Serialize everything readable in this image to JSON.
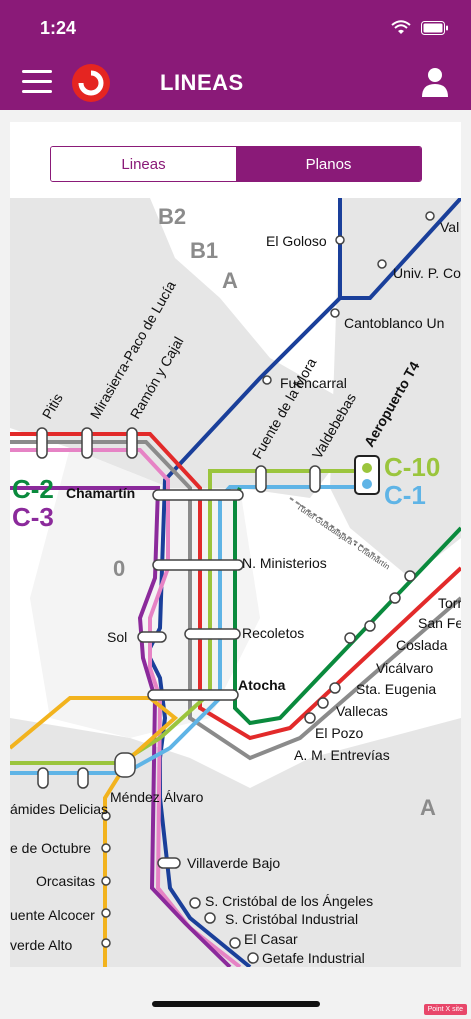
{
  "status": {
    "time": "1:24"
  },
  "header": {
    "title": "LINEAS"
  },
  "tabs": [
    {
      "label": "Lineas",
      "active": false
    },
    {
      "label": "Planos",
      "active": true
    }
  ],
  "map": {
    "zones": [
      "B2",
      "B1",
      "A",
      "0",
      "A"
    ],
    "stations": {
      "el_goloso": "El Goloso",
      "val": "Val",
      "univ_p_co": "Univ. P. Co",
      "cantoblanco": "Cantoblanco Un",
      "fuencarral": "Fuencarral",
      "pitis": "Pitis",
      "mirasierra": "Mirasierra-Paco de Lucía",
      "ramon_cajal": "Ramón y Cajal",
      "fuente_mora": "Fuente de la Mora",
      "valdebebas": "Valdebebas",
      "aeropuerto": "Aeropuerto T4",
      "chamartin": "Chamartín",
      "nuevos_ministerios": "N. Ministerios",
      "recoletos": "Recoletos",
      "sol": "Sol",
      "atocha": "Atocha",
      "torr": "Torr",
      "san_fe": "San Fe",
      "coslada": "Coslada",
      "vicalvaro": "Vicálvaro",
      "sta_eugenia": "Sta. Eugenia",
      "vallecas": "Vallecas",
      "el_pozo": "El Pozo",
      "am_entrevias": "A. M. Entrevías",
      "piramides_delicias": "ámides Delicias",
      "mendez_alvaro": "Méndez Álvaro",
      "doce_octubre": "e de Octubre",
      "orcasitas": "Orcasitas",
      "puente_alcocer": "uente Alcocer",
      "villaverde_bajo": "Villaverde Bajo",
      "villaverde_alto": "verde Alto",
      "s_cristobal_angeles": "S. Cristóbal de los Ángeles",
      "s_cristobal_industrial": "S. Cristóbal Industrial",
      "el_casar": "El Casar",
      "getafe_industrial": "Getafe Industrial"
    },
    "lines": {
      "c2": "C-2",
      "c3": "C-3",
      "c10": "C-10",
      "c1": "C-1"
    },
    "tunnel_label": "Túnel Guadalajara • Chamartín"
  },
  "colors": {
    "brand": "#8a1a78",
    "c1": "#5fb4e6",
    "c2": "#0a8a3d",
    "c3": "#8b2a9b",
    "c4": "#1a3f9a",
    "c5": "#f2b31e",
    "c7": "#e22a2a",
    "c8": "#8b8b8b",
    "c10": "#9bc53d",
    "c_pink": "#e683c5"
  },
  "footer": {
    "badge": "Point X site"
  }
}
